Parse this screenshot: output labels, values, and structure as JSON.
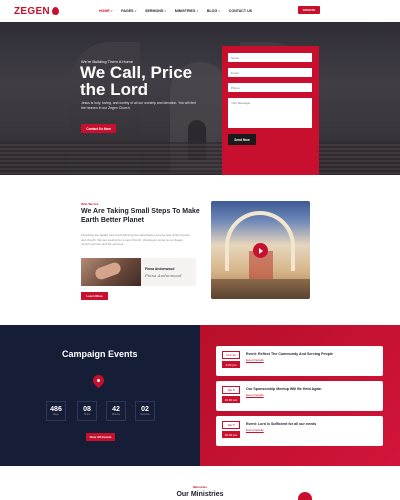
{
  "header": {
    "logo": "ZEGEN",
    "nav": [
      "HOME",
      "PAGES",
      "SERMONS",
      "MINISTRIES",
      "BLOG",
      "CONTACT US"
    ],
    "nav_active": 0,
    "donate": "DONATE"
  },
  "hero": {
    "tagline": "We're Building Them A Home",
    "title": "We Call, Price the Lord",
    "description": "Jesus is holy, loving, and worthy of all our worship and devotion. You will feel the heaven in our Zegen Church.",
    "button": "Contact Us Now"
  },
  "form": {
    "name_placeholder": "Name",
    "email_placeholder": "Email",
    "phone_placeholder": "Phone",
    "message_placeholder": "Your Message",
    "send": "Send Now"
  },
  "about": {
    "small": "Who We Are",
    "title": "We Are Taking Small Steps To Make Earth Better Planet",
    "text": "Financing the health care and financing the individual to send a new child to home and church. We are looking for a new Church. Volunteers come to our Zegen Church service and life services.",
    "pastor_name": "Fiona Andonwood",
    "pastor_signature": "Fiona Andonwood",
    "button": "Learn More"
  },
  "campaign": {
    "title": "Campaign Events",
    "countdown": [
      {
        "value": "486",
        "label": "Days"
      },
      {
        "value": "08",
        "label": "Hours"
      },
      {
        "value": "42",
        "label": "Minutes"
      },
      {
        "value": "02",
        "label": "Seconds"
      }
    ],
    "button": "View All Events",
    "events": [
      {
        "date": "Feb 12",
        "time": "2:00 pm",
        "title": "Event: Reflect The Community And Serving People",
        "link": "Event Details"
      },
      {
        "date": "Jan 8",
        "time": "10:00 am",
        "title": "Our Sponsorship Meetup Will Be Held Again",
        "link": "Event Details"
      },
      {
        "date": "Jan 5",
        "time": "02:00 pm",
        "title": "Event: Lord is Sufficient for all our needs",
        "link": "Event Details"
      }
    ]
  },
  "ministries": {
    "small": "Ministries",
    "title": "Our Ministries"
  },
  "colors": {
    "accent": "#c8102e",
    "dark": "#161d36"
  }
}
